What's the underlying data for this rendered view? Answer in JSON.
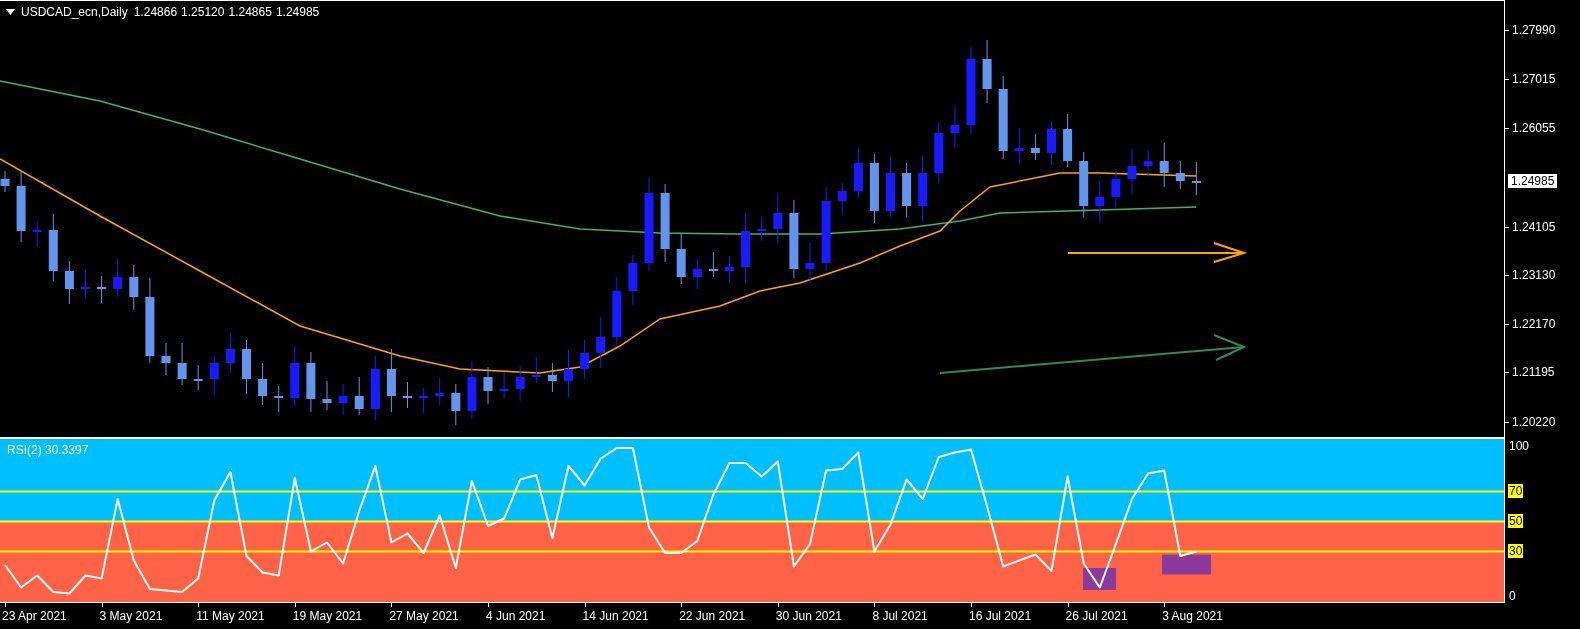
{
  "header": {
    "symbol": "USDCAD_ecn,Daily",
    "quotes": [
      "1.24866",
      "1.25120",
      "1.24865",
      "1.24985"
    ]
  },
  "price_axis": {
    "ticks": [
      "1.27990",
      "1.27015",
      "1.26055",
      "1.24105",
      "1.23130",
      "1.22170",
      "1.21195",
      "1.20220"
    ],
    "current_price": "1.24985"
  },
  "rsi_panel": {
    "chart_data": {
      "type": "line",
      "title": "RSI(2) 30.3397",
      "ylim": [
        -5,
        105
      ],
      "yticks": [
        0,
        30,
        50,
        70,
        100
      ],
      "grid": true,
      "series": [
        {
          "color": "#ffffff",
          "values": [
            21,
            6,
            14,
            3,
            2,
            14,
            12,
            65,
            24,
            5,
            4,
            3,
            12,
            64,
            83,
            27,
            16,
            14,
            79,
            30,
            36,
            22,
            57,
            87,
            36,
            42,
            29,
            54,
            19,
            77,
            47,
            52,
            78,
            81,
            39,
            87,
            74,
            92,
            99,
            99,
            46,
            29,
            29,
            37,
            68,
            89,
            89,
            80,
            90,
            20,
            35,
            84,
            85,
            96,
            30,
            48,
            78,
            65,
            93,
            96,
            98,
            60,
            20,
            24,
            28,
            17,
            80,
            22,
            6,
            35,
            65,
            82,
            84,
            27,
            30
          ]
        }
      ]
    }
  },
  "date_axis": [
    "23 Apr 2021",
    "3 May 2021",
    "11 May 2021",
    "19 May 2021",
    "27 May 2021",
    "4 Jun 2021",
    "14 Jun 2021",
    "22 Jun 2021",
    "30 Jun 2021",
    "8 Jul 2021",
    "16 Jul 2021",
    "26 Jul 2021",
    "3 Aug 2021"
  ]
}
